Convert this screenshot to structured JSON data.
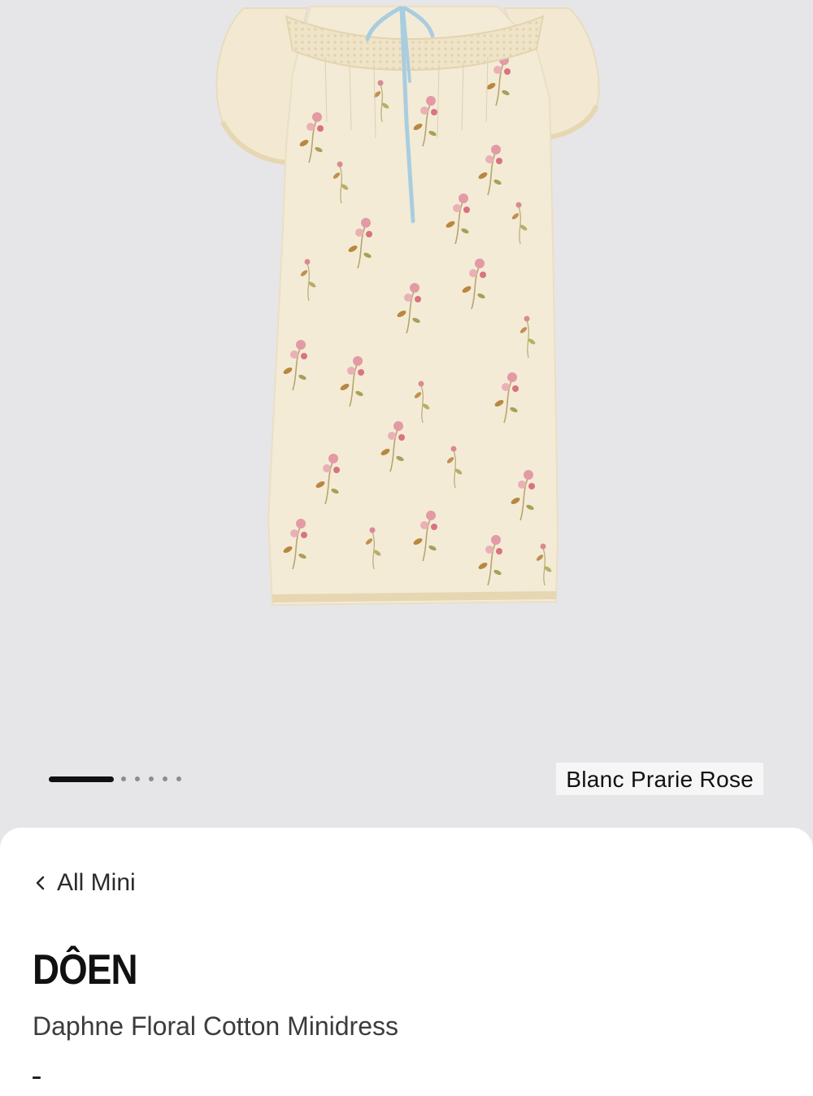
{
  "product": {
    "brand": "DÔEN",
    "name": "Daphne Floral Cotton Minidress",
    "color": "Blanc Prarie Rose"
  },
  "gallery": {
    "image_icon": "floral-minidress-product-photo",
    "total_slides": 6,
    "current_slide": 1,
    "background": "#e6e6e8"
  },
  "nav": {
    "back_label": "All Mini",
    "back_icon": "chevron-left-icon"
  },
  "colors": {
    "text_primary": "#111111",
    "text_secondary": "#3c3c3c",
    "sheet": "#ffffff",
    "dress_base": "#f4ebd6",
    "ribbon": "#a9cde0"
  }
}
